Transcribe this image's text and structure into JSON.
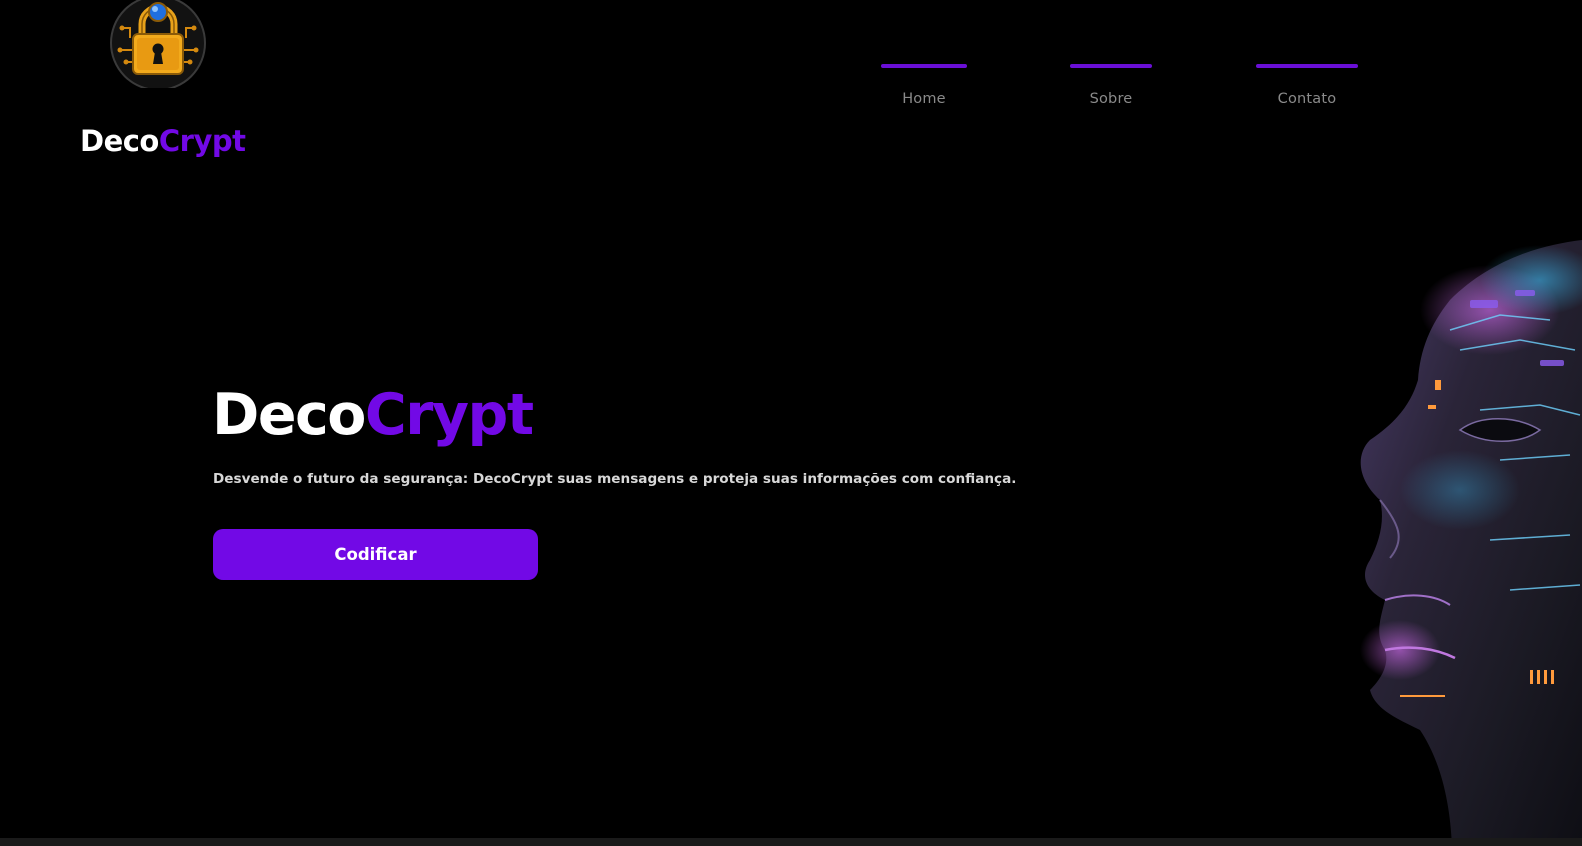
{
  "brand": {
    "part1": "Deco",
    "part2": "Crypt"
  },
  "nav": {
    "items": [
      {
        "label": "Home"
      },
      {
        "label": "Sobre"
      },
      {
        "label": "Contato"
      }
    ]
  },
  "hero": {
    "title_part1": "Deco",
    "title_part2": "Crypt",
    "subtitle": "Desvende o futuro da segurança: DecoCrypt suas mensagens e proteja suas informações com confiança.",
    "cta_label": "Codificar"
  },
  "colors": {
    "accent": "#7209e6",
    "background": "#000000",
    "text": "#ffffff",
    "nav_text": "#8a8a8a"
  },
  "icons": {
    "logo": "padlock-emblem-icon",
    "hero_image": "cyborg-face-image"
  }
}
